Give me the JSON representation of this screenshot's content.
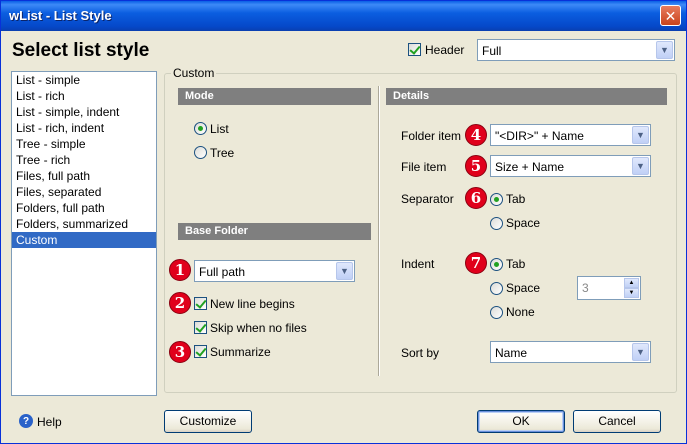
{
  "window": {
    "title": "wList - List Style",
    "close_glyph": "✕"
  },
  "page_title": "Select list style",
  "header": {
    "checkbox_label": "Header",
    "checked": true,
    "select_value": "Full"
  },
  "styles_list": {
    "items": [
      "List - simple",
      "List - rich",
      "List - simple, indent",
      "List - rich, indent",
      "Tree - simple",
      "Tree - rich",
      "Files, full path",
      "Files, separated",
      "Folders, full path",
      "Folders, summarized",
      "Custom"
    ],
    "selected": "Custom"
  },
  "custom_group": {
    "legend": "Custom",
    "mode": {
      "header": "Mode",
      "options": [
        "List",
        "Tree"
      ],
      "selected": "List"
    },
    "base_folder": {
      "header": "Base Folder",
      "select_value": "Full path",
      "new_line_begins": "New line begins",
      "skip_when_no_files": "Skip when no files",
      "summarize": "Summarize"
    },
    "details": {
      "header": "Details",
      "folder_item_label": "Folder item",
      "folder_item_value": "\"<DIR>\" + Name",
      "file_item_label": "File item",
      "file_item_value": "Size + Name",
      "separator_label": "Separator",
      "separator_options": [
        "Tab",
        "Space"
      ],
      "separator_selected": "Tab",
      "indent_label": "Indent",
      "indent_options": [
        "Tab",
        "Space",
        "None"
      ],
      "indent_selected": "Tab",
      "indent_space_count": "3",
      "sort_by_label": "Sort by",
      "sort_by_value": "Name"
    }
  },
  "badges": [
    "1",
    "2",
    "3",
    "4",
    "5",
    "6",
    "7"
  ],
  "footer": {
    "help": "Help",
    "customize": "Customize",
    "ok": "OK",
    "cancel": "Cancel"
  },
  "icons": {
    "help": "help-icon",
    "dropdown": "chevron-down-icon",
    "close": "close-icon"
  },
  "colors": {
    "title_bar": "#0548c9",
    "selection": "#316ac5",
    "badge": "#e0001b",
    "section_header": "#7f7f7f"
  }
}
